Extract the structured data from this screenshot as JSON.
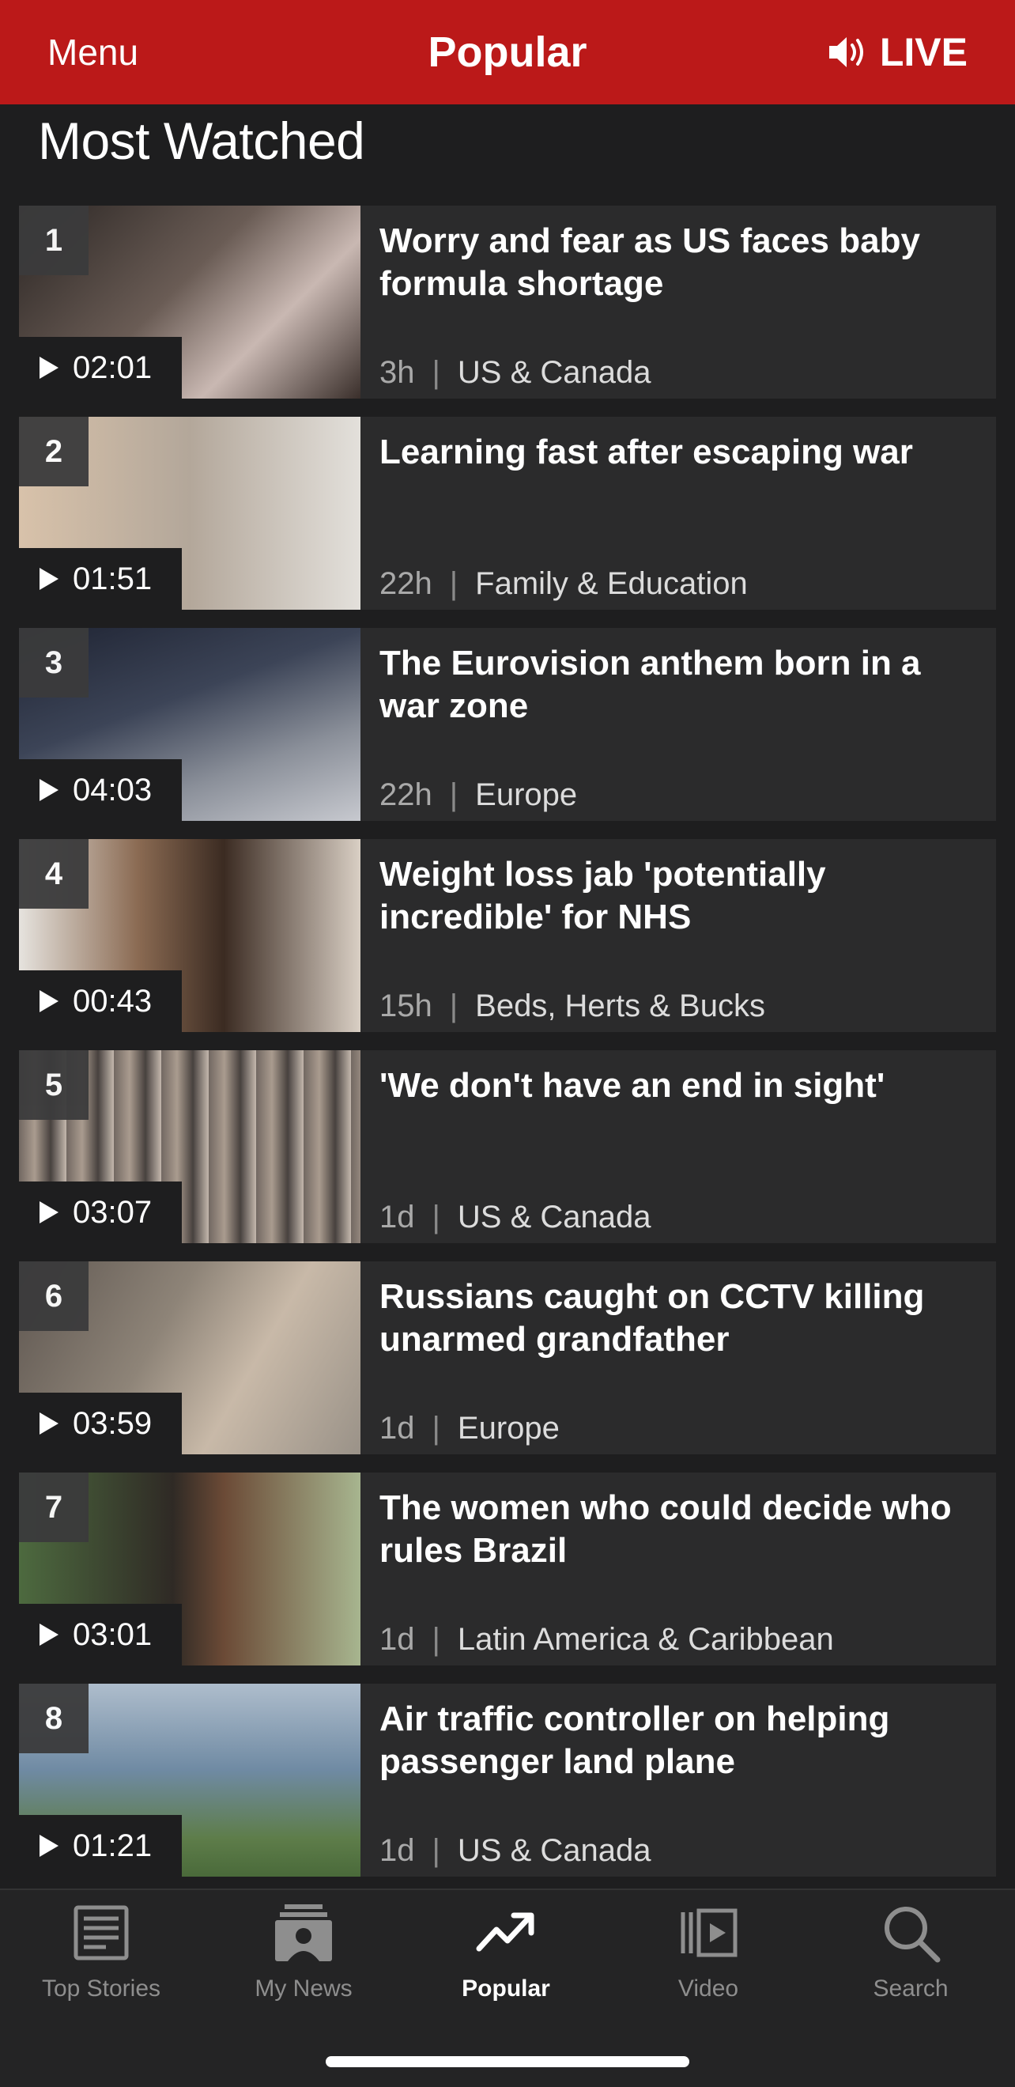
{
  "header": {
    "menu_label": "Menu",
    "title": "Popular",
    "live_label": "LIVE",
    "icons": {
      "live": "speaker-icon"
    }
  },
  "section_title": "Most Watched",
  "items": [
    {
      "rank": "1",
      "duration": "02:01",
      "headline": "Worry and fear as US faces baby formula shortage",
      "age": "3h",
      "category": "US & Canada",
      "thumb_color": "#6a5c55"
    },
    {
      "rank": "2",
      "duration": "01:51",
      "headline": "Learning fast after escaping war",
      "age": "22h",
      "category": "Family & Education",
      "thumb_color": "#b3a79a"
    },
    {
      "rank": "3",
      "duration": "04:03",
      "headline": "The Eurovision anthem born in a war zone",
      "age": "22h",
      "category": "Europe",
      "thumb_color": "#3c4457"
    },
    {
      "rank": "4",
      "duration": "00:43",
      "headline": "Weight loss jab 'potentially incredible' for NHS",
      "age": "15h",
      "category": "Beds, Herts & Bucks",
      "thumb_color": "#8a6a52"
    },
    {
      "rank": "5",
      "duration": "03:07",
      "headline": "'We don't have an end in sight'",
      "age": "1d",
      "category": "US & Canada",
      "thumb_color": "#7a6f68"
    },
    {
      "rank": "6",
      "duration": "03:59",
      "headline": "Russians caught on CCTV killing unarmed grandfather",
      "age": "1d",
      "category": "Europe",
      "thumb_color": "#8e8478"
    },
    {
      "rank": "7",
      "duration": "03:01",
      "headline": "The women who could decide who rules Brazil",
      "age": "1d",
      "category": "Latin America & Caribbean",
      "thumb_color": "#4d6a3f"
    },
    {
      "rank": "8",
      "duration": "01:21",
      "headline": "Air traffic controller on helping passenger land plane",
      "age": "1d",
      "category": "US & Canada",
      "thumb_color": "#6f8aa3"
    }
  ],
  "tabs": [
    {
      "label": "Top Stories",
      "icon": "newspaper-icon",
      "active": false
    },
    {
      "label": "My News",
      "icon": "my-news-icon",
      "active": false
    },
    {
      "label": "Popular",
      "icon": "trending-icon",
      "active": true
    },
    {
      "label": "Video",
      "icon": "video-icon",
      "active": false
    },
    {
      "label": "Search",
      "icon": "search-icon",
      "active": false
    }
  ],
  "colors": {
    "brand_red": "#bb1919",
    "background": "#1e1e1f",
    "card": "#2b2b2c"
  }
}
